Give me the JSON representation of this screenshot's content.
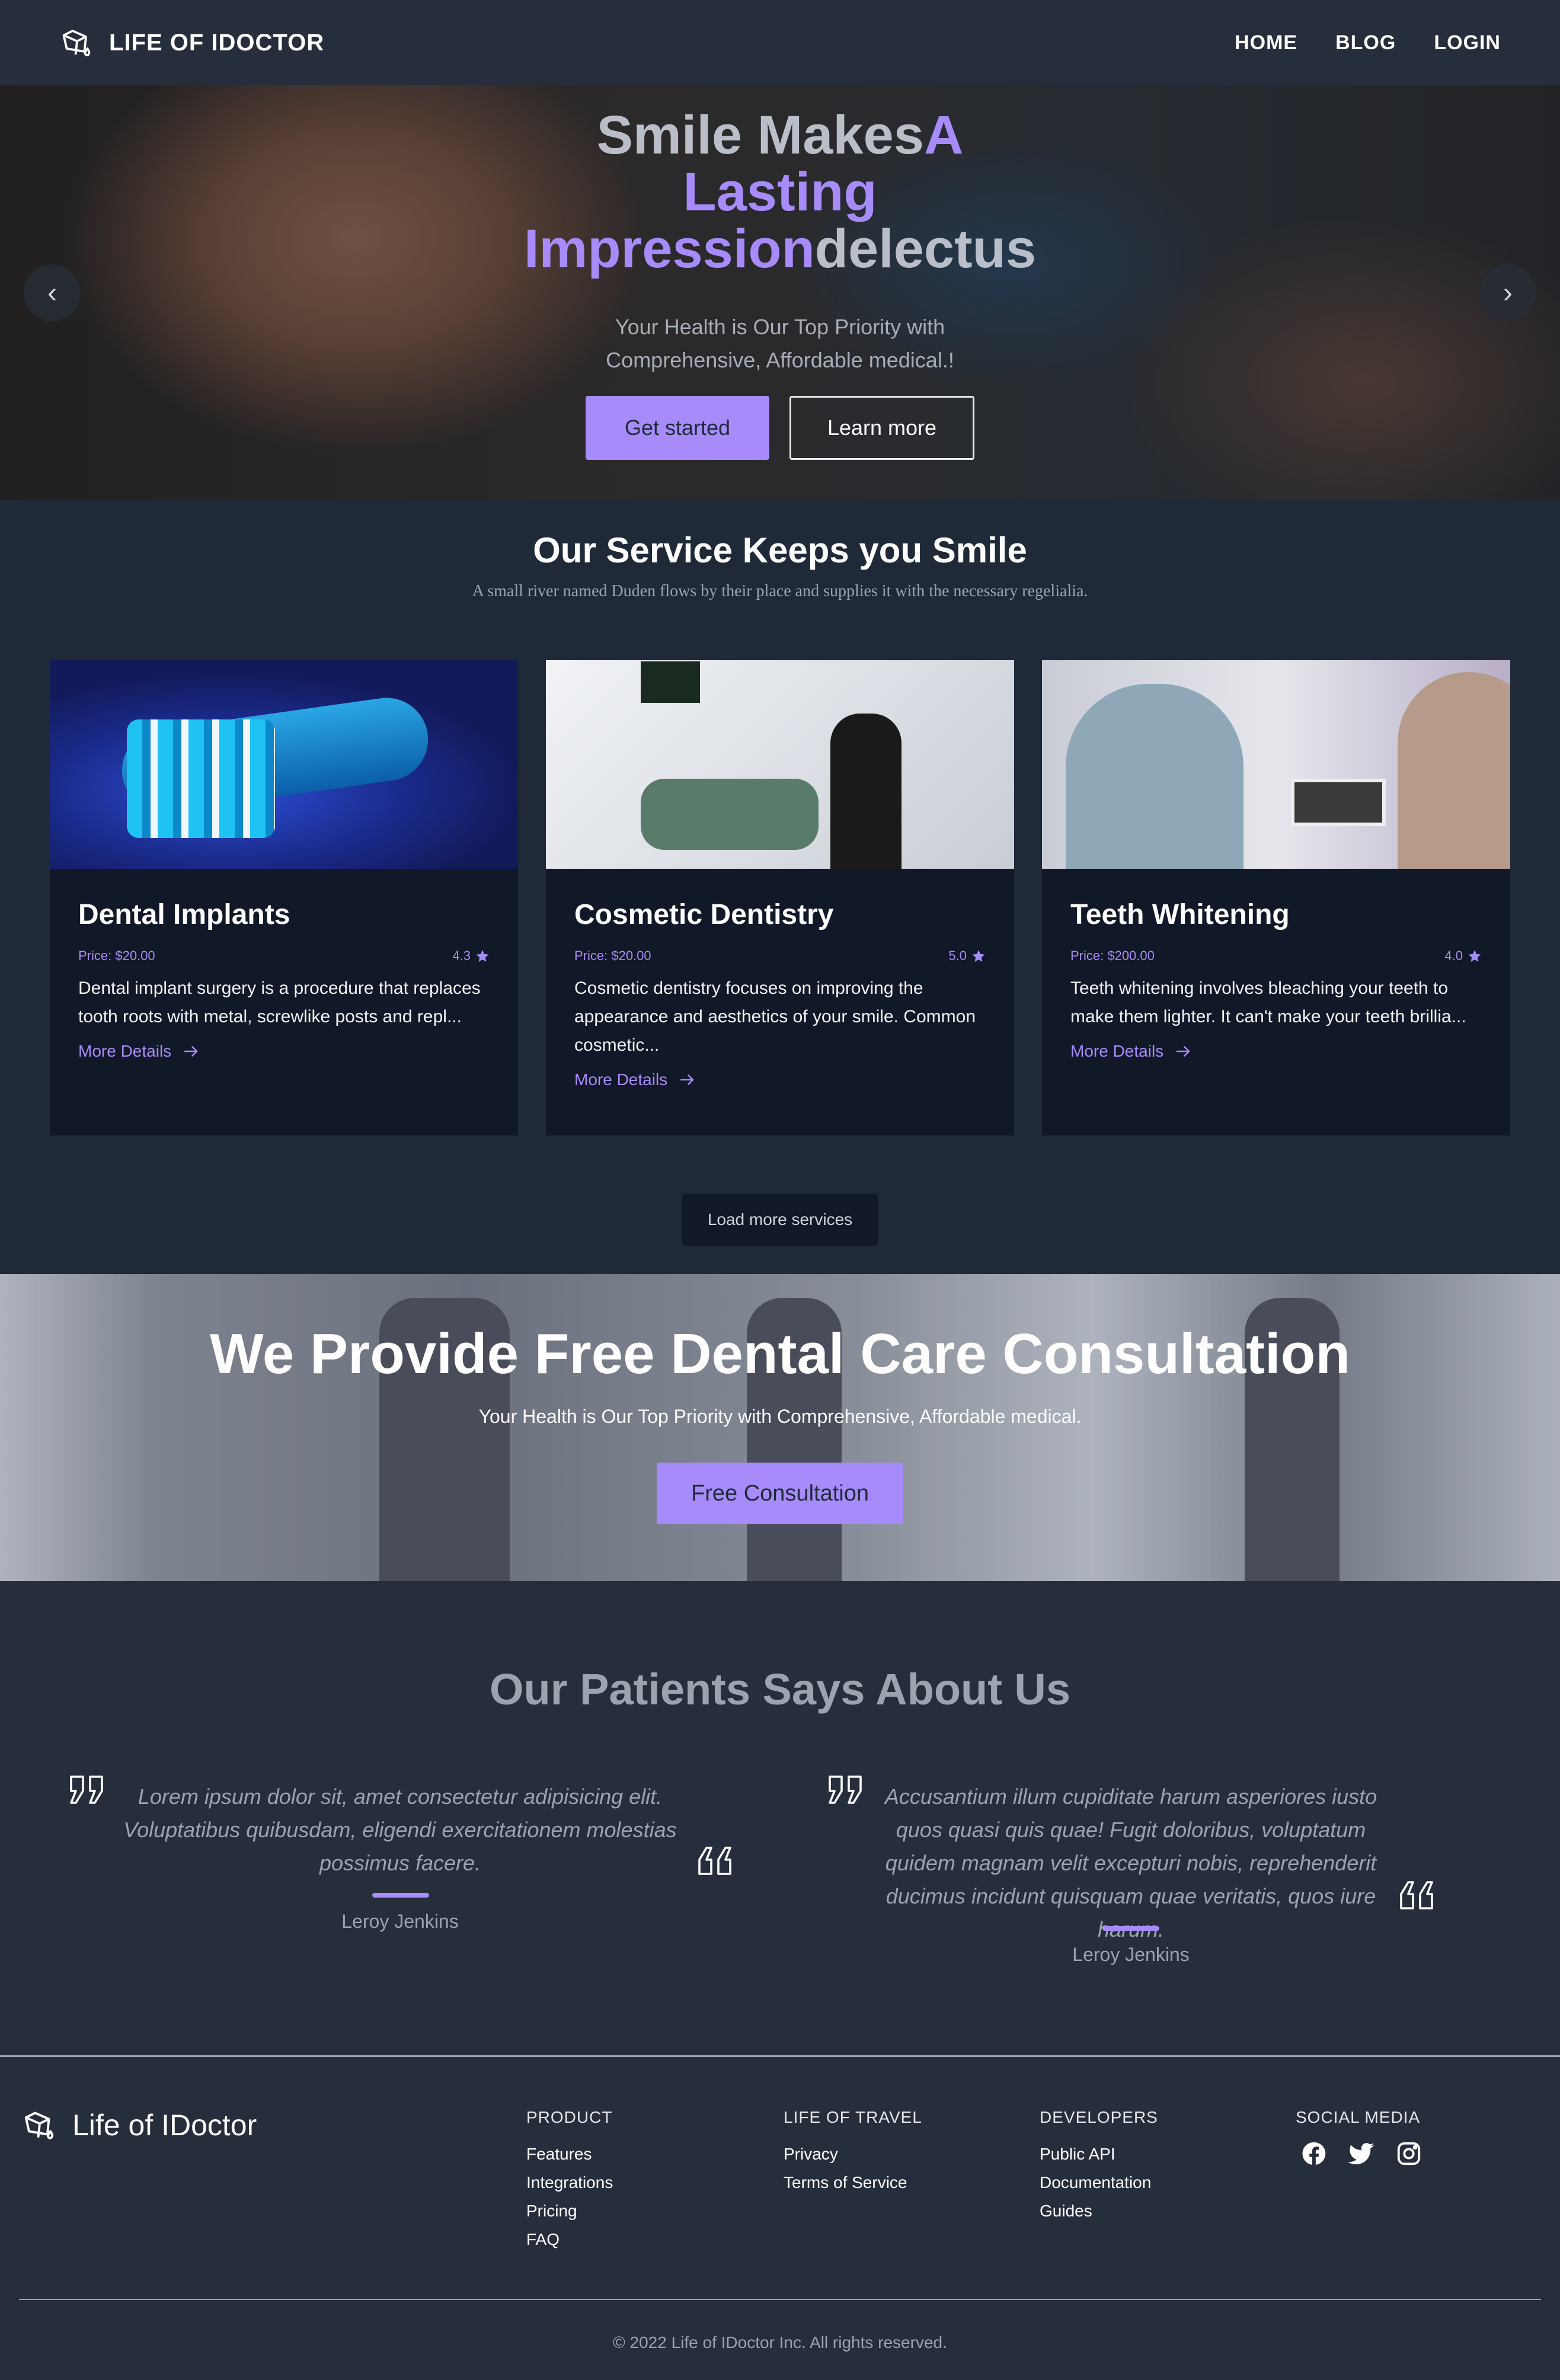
{
  "nav": {
    "brand": "LIFE OF IDOCTOR",
    "brand_icon": "tooth-cleaning-icon",
    "links": [
      "HOME",
      "BLOG",
      "LOGIN"
    ]
  },
  "hero": {
    "title_part1": "Smile Makes",
    "title_accent": "A Lasting Impression",
    "title_part2": "delectus",
    "subtitle": "Your Health is Our Top Priority with Comprehensive, Affordable medical.!",
    "primary_button": "Get started",
    "secondary_button": "Learn more",
    "prev_arrow": "‹",
    "next_arrow": "›"
  },
  "services": {
    "title": "Our Service Keeps you Smile",
    "subtitle": "A small river named Duden flows by their place and supplies it with the necessary regelialia.",
    "cards": [
      {
        "title": "Dental Implants",
        "price": "Price: $20.00",
        "rating": "4.3",
        "description": "Dental implant surgery is a procedure that replaces tooth roots with metal, screwlike posts and repl...",
        "link": "More Details"
      },
      {
        "title": "Cosmetic Dentistry",
        "price": "Price: $20.00",
        "rating": "5.0",
        "description": "Cosmetic dentistry focuses on improving the appearance and aesthetics of your smile. Common cosmetic...",
        "link": "More Details"
      },
      {
        "title": "Teeth Whitening",
        "price": "Price: $200.00",
        "rating": "4.0",
        "description": "Teeth whitening involves bleaching your teeth to make them lighter. It can't make your teeth brillia...",
        "link": "More Details"
      }
    ],
    "load_more": "Load more services"
  },
  "consultation": {
    "title": "We Provide Free Dental Care Consultation",
    "subtitle": "Your Health is Our Top Priority with Comprehensive, Affordable medical.",
    "button": "Free Consultation"
  },
  "testimonials": {
    "title": "Our Patients Says About Us",
    "items": [
      {
        "text": "Lorem ipsum dolor sit, amet consectetur adipisicing elit. Voluptatibus quibusdam, eligendi exercitationem molestias possimus facere.",
        "name": "Leroy Jenkins"
      },
      {
        "text": "Accusantium illum cupiditate harum asperiores iusto quos quasi quis quae! Fugit doloribus, voluptatum quidem magnam velit excepturi nobis, reprehenderit ducimus incidunt quisquam quae veritatis, quos iure harum.",
        "name": "Leroy Jenkins"
      }
    ]
  },
  "footer": {
    "brand": "Life of IDoctor",
    "columns": [
      {
        "title": "PRODUCT",
        "items": [
          "Features",
          "Integrations",
          "Pricing",
          "FAQ"
        ]
      },
      {
        "title": "LIFE OF TRAVEL",
        "items": [
          "Privacy",
          "Terms of Service"
        ]
      },
      {
        "title": "DEVELOPERS",
        "items": [
          "Public API",
          "Documentation",
          "Guides"
        ]
      }
    ],
    "social_title": "SOCIAL MEDIA",
    "social_icons": [
      "facebook-icon",
      "twitter-icon",
      "instagram-icon"
    ],
    "copyright": "© 2022 Life of IDoctor Inc. All rights reserved."
  },
  "colors": {
    "accent": "#a78bfa",
    "nav_bg": "#272e3b",
    "page_bg": "#1f2937",
    "card_bg": "#111827"
  }
}
